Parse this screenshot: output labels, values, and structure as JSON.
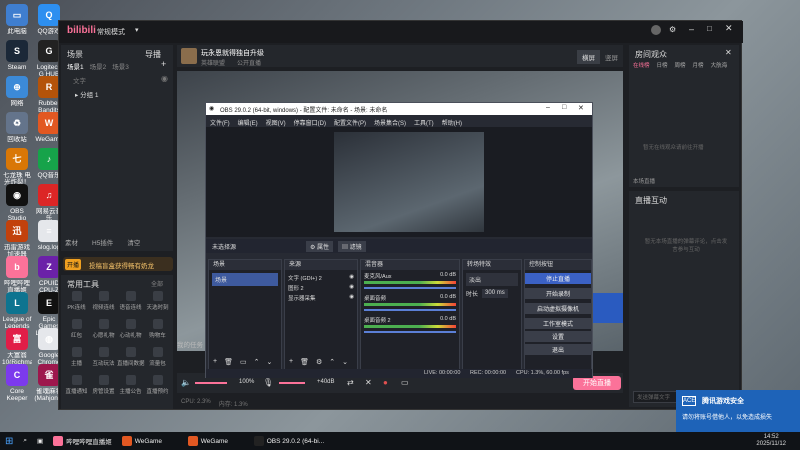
{
  "desktop": {
    "icons": [
      {
        "name": "pc",
        "label": "此电脑",
        "color": "#3f7ecf",
        "glyph": "▭"
      },
      {
        "name": "qqgame",
        "label": "QQ游戏",
        "color": "#2d8ff0",
        "glyph": "Q"
      },
      {
        "name": "steam",
        "label": "Steam",
        "color": "#1b2838",
        "glyph": "S"
      },
      {
        "name": "ghub",
        "label": "Logitech G HUB",
        "color": "#222",
        "glyph": "G"
      },
      {
        "name": "network",
        "label": "网络",
        "color": "#3c8ad8",
        "glyph": "⊕"
      },
      {
        "name": "rubber",
        "label": "Rubber Bandits",
        "color": "#b45309",
        "glyph": "R"
      },
      {
        "name": "recycle",
        "label": "回收站",
        "color": "#64748b",
        "glyph": "♻"
      },
      {
        "name": "wegame",
        "label": "WeGame",
        "color": "#e25822",
        "glyph": "W"
      },
      {
        "name": "qimo",
        "label": "七龙珠 电光炸裂！ZERO",
        "color": "#d97706",
        "glyph": "七"
      },
      {
        "name": "qqmusic",
        "label": "QQ音乐",
        "color": "#16a34a",
        "glyph": "♪"
      },
      {
        "name": "obs",
        "label": "OBS Studio",
        "color": "#111",
        "glyph": "◉"
      },
      {
        "name": "netease",
        "label": "网易云音乐",
        "color": "#dc2626",
        "glyph": "♫"
      },
      {
        "name": "acc",
        "label": "迅雷游戏加速器",
        "color": "#c2410c",
        "glyph": "迅"
      },
      {
        "name": "slog",
        "label": "slog.log",
        "color": "#e5e7eb",
        "glyph": "≡"
      },
      {
        "name": "bilibili",
        "label": "哔哩哔哩直播姬",
        "color": "#fb7299",
        "glyph": "b"
      },
      {
        "name": "cpuid",
        "label": "CPUID CPU-Z",
        "color": "#6b21a8",
        "glyph": "Z"
      },
      {
        "name": "lol",
        "label": "League of Legends",
        "color": "#0e7490",
        "glyph": "L"
      },
      {
        "name": "epic",
        "label": "Epic Games Launcher",
        "color": "#111",
        "glyph": "E"
      },
      {
        "name": "dabao",
        "label": "大富翁10(Richman)",
        "color": "#e11d48",
        "glyph": "富"
      },
      {
        "name": "chrome",
        "label": "Google Chrome",
        "color": "#e5e7eb",
        "glyph": "◍"
      },
      {
        "name": "core",
        "label": "Core Keeper",
        "color": "#7c3aed",
        "glyph": "C"
      },
      {
        "name": "mahjong",
        "label": "雀魂麻将(Mahjong)",
        "color": "#9d174d",
        "glyph": "雀"
      }
    ]
  },
  "bili": {
    "logo": "bilibili",
    "mode": "常规模式",
    "scenes_title": "场景",
    "import": "导播",
    "scene_tabs": [
      "场景1",
      "场景2",
      "场景3"
    ],
    "search_placeholder": "文字",
    "group": "分组 1",
    "bottom_tools": [
      "素材",
      "H5插件",
      "清空"
    ],
    "promo_badge": "开播",
    "promo_text": "投稿盲盒获得畅有奶龙",
    "tools_title": "常用工具",
    "tools_all": "全部",
    "tools": [
      "PK连线",
      "视频连线",
      "语音连线",
      "天选时刻",
      "红包",
      "心愿礼物",
      "心动礼物",
      "购物车",
      "主播",
      "互动玩法",
      "直播间数据",
      "流量包",
      "直播通知",
      "房管设置",
      "主播公告",
      "直播预约"
    ],
    "stream_title": "玩永恩就得独自升级",
    "category": "英雄联盟",
    "public": "公开直播",
    "layout_tabs": [
      "横屏",
      "竖屏"
    ],
    "task_text": "我的任务",
    "audio": {
      "vol1": "100%",
      "vol2": "+40dB"
    },
    "status": {
      "cpu": "CPU: 2.3%",
      "mem": "内存: 1.3%"
    },
    "start_button": "开始直播",
    "room_title": "房间观众",
    "room_tabs": [
      "在线榜",
      "日榜",
      "周榜",
      "月榜",
      "大航海"
    ],
    "room_empty": "暂无在线观众请前往开播",
    "room_footer": "本场直播",
    "interact_title": "直播互动",
    "interact_empty": "暂无本场直播的弹幕评论，点击发言参与互动",
    "chat_placeholder": "发送弹幕文字"
  },
  "obs": {
    "title": "OBS 29.0.2 (64-bit, windows) - 配置文件: 未命名 - 场景: 未命名",
    "menu": [
      "文件(F)",
      "编辑(E)",
      "视图(V)",
      "停靠窗口(D)",
      "配置文件(P)",
      "场景集合(S)",
      "工具(T)",
      "帮助(H)"
    ],
    "source_label": "未选择源",
    "props": "属性",
    "filters": "滤镜",
    "docks": {
      "scenes": "场景",
      "sources": "来源",
      "mixer": "混音器",
      "transitions": "转场特效",
      "controls": "控制按钮"
    },
    "scene_items": [
      "场景"
    ],
    "source_items": [
      "文字 (GDI+) 2",
      "图形 2",
      "显示器采集"
    ],
    "mixer": [
      {
        "name": "麦克风/Aux",
        "db": "0.0 dB"
      },
      {
        "name": "桌面音频",
        "db": "0.0 dB"
      },
      {
        "name": "桌面音频 2",
        "db": "0.0 dB"
      }
    ],
    "transition": {
      "type": "淡出",
      "duration_label": "时长",
      "duration": "300 ms"
    },
    "controls": [
      "停止直播",
      "开始录制",
      "启动虚拟摄像机",
      "工作室模式",
      "设置",
      "退出"
    ],
    "statusbar": {
      "live": "LIVE: 00:00:00",
      "rec": "REC: 00:00:00",
      "cpu": "CPU: 1.3%, 60.00 fps"
    }
  },
  "toast": {
    "title": "腾讯游戏安全",
    "body": "请勿将账号借他人，以免造成损失"
  },
  "taskbar": {
    "items": [
      "哔哩哔哩直播姬",
      "WeGame",
      "WeGame",
      "OBS 29.0.2 (64-bi..."
    ],
    "time": "14:52",
    "date": "2025/11/12"
  },
  "colors": {
    "accent": "#fb7299",
    "obs_red": "#c0392b",
    "toast": "#1e63b8"
  }
}
